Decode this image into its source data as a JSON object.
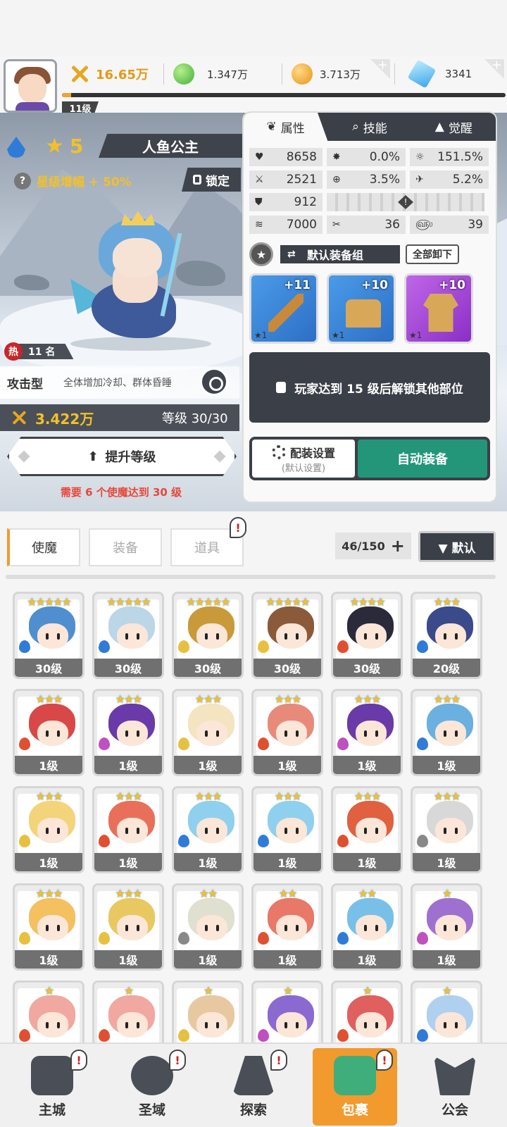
{
  "player": {
    "level": "11级",
    "xp_progress": 0.02
  },
  "resources": {
    "power": "16.65万",
    "green_gem": "1.347万",
    "gold": "3.713万",
    "diamond": "3341",
    "plus": "+"
  },
  "hero": {
    "star_count": "5",
    "star_glyph": "★",
    "name": "人鱼公主",
    "star_boost": "星级增幅 + 50%",
    "question_mark": "?",
    "lock_label": "锁定",
    "hot_label": "热",
    "hot_rank": "11 名",
    "type": "攻击型",
    "skill_desc": "全体增加冷却、群体昏睡",
    "power": "3.422万",
    "level_label": "等级 30/30",
    "upgrade_label": "提升等级",
    "upgrade_requirement": "需要 6 个使魔达到 30 级"
  },
  "panel": {
    "tabs": [
      "属性",
      "技能",
      "觉醒"
    ],
    "stats": {
      "hp": "8658",
      "crit": "0.0%",
      "crit_dmg": "151.5%",
      "atk": "2521",
      "hit": "3.5%",
      "dodge": "5.2%",
      "def": "912",
      "speed": "7000",
      "stat_a": "36",
      "stat_b": "39",
      "warn": "!"
    },
    "equip_group": "默认装备组",
    "unload_all": "全部卸下",
    "slots": [
      {
        "plus": "+11",
        "stars": "★1",
        "color": "#3f8ee0"
      },
      {
        "plus": "+10",
        "stars": "★1",
        "color": "#3f8ee0"
      },
      {
        "plus": "+10",
        "stars": "★1",
        "color": "#b258e0"
      }
    ],
    "locked_msg": "玩家达到 15 级后解锁其他部位",
    "config_label": "配装设置",
    "config_sub": "(默认设置)",
    "auto_equip": "自动装备"
  },
  "list": {
    "tabs": [
      "使魔",
      "装备",
      "道具"
    ],
    "count": "46/150",
    "count_plus": "+",
    "sort": "▼ 默认",
    "alert": "!",
    "cards": [
      {
        "stars": "★★★★★",
        "level": "30级",
        "hair": "#4f8fcf",
        "elem": "#2f7bd8"
      },
      {
        "stars": "★★★★★",
        "level": "30级",
        "hair": "#bcd6e8",
        "elem": "#2f7bd8"
      },
      {
        "stars": "★★★★★",
        "level": "30级",
        "hair": "#c99a3a",
        "elem": "#e8c040"
      },
      {
        "stars": "★★★★★",
        "level": "30级",
        "hair": "#8a5a3a",
        "elem": "#e8c040"
      },
      {
        "stars": "★★★★",
        "level": "30级",
        "hair": "#2a2a3a",
        "elem": "#e05030"
      },
      {
        "stars": "★★★",
        "level": "20级",
        "hair": "#3a4a8a",
        "elem": "#2f7bd8"
      },
      {
        "stars": "★★★",
        "level": "1级",
        "hair": "#d84848",
        "elem": "#e05030"
      },
      {
        "stars": "★★★",
        "level": "1级",
        "hair": "#6a3aa8",
        "elem": "#c050c0"
      },
      {
        "stars": "★★★",
        "level": "1级",
        "hair": "#f4e4c0",
        "elem": "#e8c040"
      },
      {
        "stars": "★★★",
        "level": "1级",
        "hair": "#e88a7a",
        "elem": "#e05030"
      },
      {
        "stars": "★★★",
        "level": "1级",
        "hair": "#6a3aa8",
        "elem": "#c050c0"
      },
      {
        "stars": "★★★",
        "level": "1级",
        "hair": "#6ab0e0",
        "elem": "#2f7bd8"
      },
      {
        "stars": "★★★",
        "level": "1级",
        "hair": "#f4d47a",
        "elem": "#e8c040"
      },
      {
        "stars": "★★★",
        "level": "1级",
        "hair": "#e8705a",
        "elem": "#e05030"
      },
      {
        "stars": "★★★",
        "level": "1级",
        "hair": "#8fd0ee",
        "elem": "#2f7bd8"
      },
      {
        "stars": "★★★",
        "level": "1级",
        "hair": "#8fd0ee",
        "elem": "#2f7bd8"
      },
      {
        "stars": "★★★",
        "level": "1级",
        "hair": "#e06040",
        "elem": "#e05030"
      },
      {
        "stars": "★★★",
        "level": "1级",
        "hair": "#d8d8d8",
        "elem": "#888888"
      },
      {
        "stars": "★★★",
        "level": "1级",
        "hair": "#f4c060",
        "elem": "#e8c040"
      },
      {
        "stars": "★★★",
        "level": "1级",
        "hair": "#e8c860",
        "elem": "#e8c040"
      },
      {
        "stars": "★★",
        "level": "1级",
        "hair": "#e0e0d0",
        "elem": "#888888"
      },
      {
        "stars": "★★",
        "level": "1级",
        "hair": "#e87868",
        "elem": "#e05030"
      },
      {
        "stars": "★★",
        "level": "1级",
        "hair": "#78c0e8",
        "elem": "#2f7bd8"
      },
      {
        "stars": "★",
        "level": "1级",
        "hair": "#a070d0",
        "elem": "#c050c0"
      },
      {
        "stars": "★",
        "level": "",
        "hair": "#f0a8a0",
        "elem": "#e05030"
      },
      {
        "stars": "★",
        "level": "",
        "hair": "#f0a8a0",
        "elem": "#e05030"
      },
      {
        "stars": "★",
        "level": "",
        "hair": "#e8c8a0",
        "elem": "#e8c040"
      },
      {
        "stars": "★",
        "level": "",
        "hair": "#8a6ad0",
        "elem": "#c050c0"
      },
      {
        "stars": "★",
        "level": "",
        "hair": "#e06060",
        "elem": "#e05030"
      },
      {
        "stars": "★",
        "level": "",
        "hair": "#b0d0f0",
        "elem": "#2f7bd8"
      }
    ]
  },
  "nav": [
    "主城",
    "圣域",
    "探索",
    "包裹",
    "公会"
  ]
}
